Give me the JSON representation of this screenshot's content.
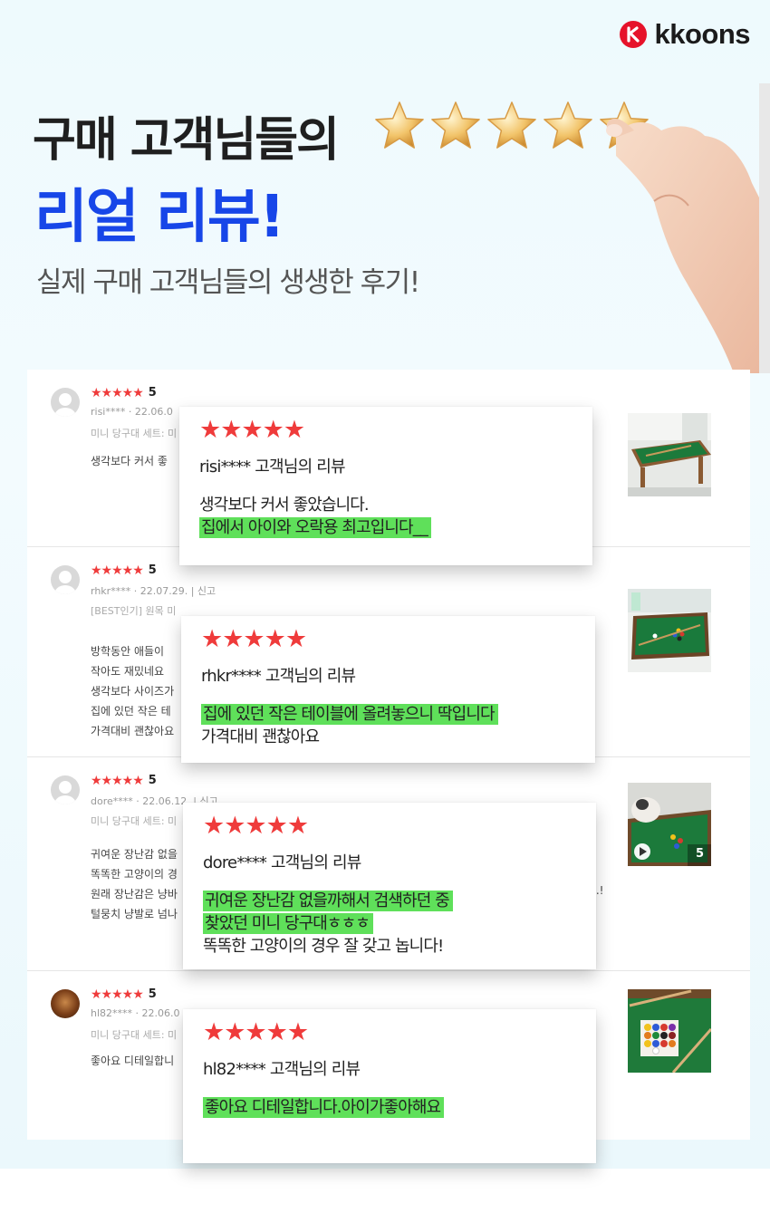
{
  "brand": {
    "name": "kkoons",
    "color": "#e6122a"
  },
  "hero": {
    "line1": "구매 고객님들의",
    "line2": "리얼 리뷰!",
    "subtitle": "실제 구매 고객님들의 생생한 후기!",
    "accent_color": "#1746e8",
    "star_count": 5
  },
  "reviews": [
    {
      "stars": "★★★★★",
      "score": "5",
      "user": "risi****",
      "date": "22.06.0",
      "option": "미니 당구대 세트: 미",
      "body": [
        "생각보다 커서 좋"
      ],
      "thumb": "pool-table-photo",
      "card": {
        "stars": "★★★★★",
        "heading": "risi****  고객님의 리뷰",
        "lines": [
          {
            "text": "생각보다 커서 좋았습니다.",
            "highlight": false
          },
          {
            "text": "집에서 아이와 오락용 최고입니다__",
            "highlight": true
          }
        ]
      }
    },
    {
      "stars": "★★★★★",
      "score": "5",
      "user": "rhkr****",
      "date": "22.07.29.",
      "report": "신고",
      "option": "[BEST인기] 원목 미",
      "body": [
        "방학동안  애들이",
        "작아도 재밌네요",
        "생각보다 사이즈가",
        "집에 있던 작은 테",
        "가격대비 괜찮아요"
      ],
      "thumb": "pool-table-photo",
      "card": {
        "stars": "★★★★★",
        "heading": "rhkr****  고객님의 리뷰",
        "lines": [
          {
            "text": "집에 있던 작은 테이블에 올려놓으니 딱입니다",
            "highlight": true
          },
          {
            "text": "가격대비 괜찮아요",
            "highlight": false
          }
        ]
      }
    },
    {
      "stars": "★★★★★",
      "score": "5",
      "user": "dore****",
      "date": "22.06.12.",
      "report": "신고",
      "option": "미니 당구대 세트: 미",
      "body": [
        "귀여운 장난감 없을",
        "똑똑한 고양이의 경",
        "원래 장난감은 냥바",
        "털뭉치 냥발로 넘나"
      ],
      "trail": "..!",
      "thumb": "cat-pool-video",
      "media_count": "5",
      "card": {
        "stars": "★★★★★",
        "heading": "dore****  고객님의 리뷰",
        "lines": [
          {
            "text": "귀여운 장난감 없을까해서 검색하던 중",
            "highlight": true
          },
          {
            "text": "찾았던 미니 당구대ㅎㅎㅎ",
            "highlight": true
          },
          {
            "text": "똑똑한 고양이의 경우 잘 갖고 놉니다!",
            "highlight": false
          }
        ]
      }
    },
    {
      "stars": "★★★★★",
      "score": "5",
      "user": "hl82****",
      "date": "22.06.0",
      "option": "미니 당구대 세트: 미",
      "body": [
        "좋아요 디테일합니"
      ],
      "thumb": "billiard-balls-photo",
      "card": {
        "stars": "★★★★★",
        "heading": "hl82****  고객님의 리뷰",
        "lines": [
          {
            "text": "좋아요 디테일합니다.아이가좋아해요",
            "highlight": true
          }
        ]
      }
    }
  ]
}
